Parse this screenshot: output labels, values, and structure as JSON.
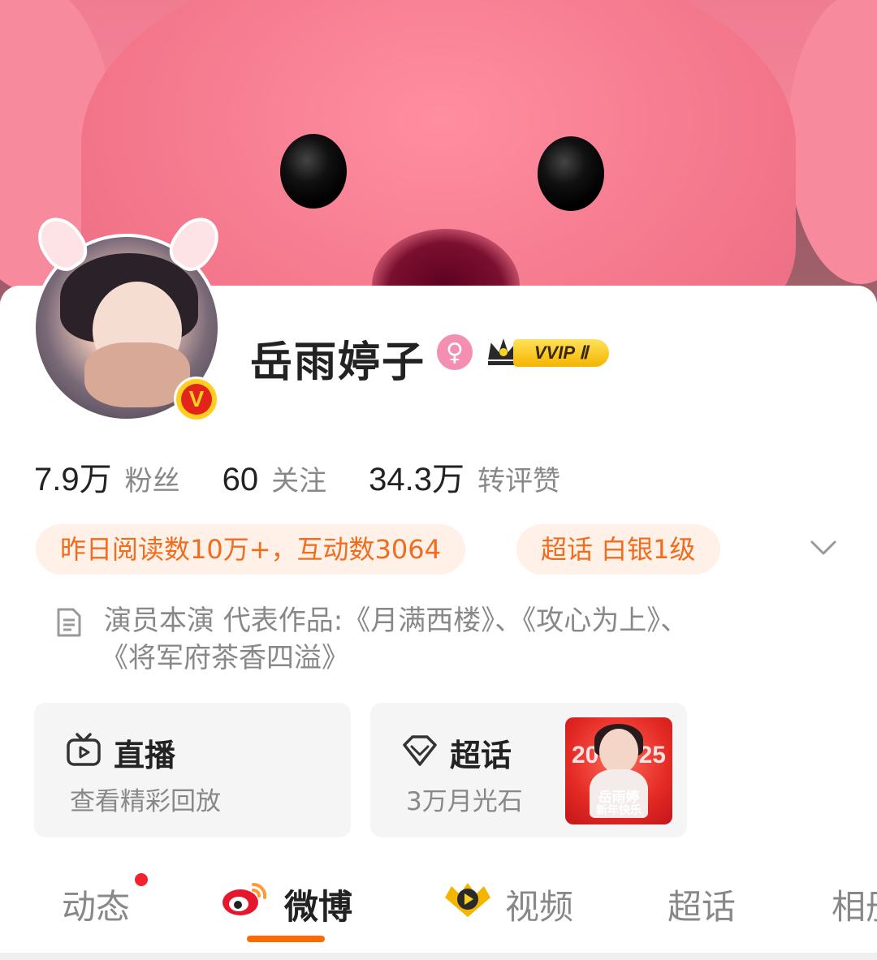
{
  "profile": {
    "name": "岳雨婷子",
    "gender_icon": "female-icon",
    "vip_label": "VVIP Ⅱ",
    "verified_badge": "V"
  },
  "stats": [
    {
      "value": "7.9万",
      "label": "粉丝"
    },
    {
      "value": "60",
      "label": "关注"
    },
    {
      "value": "34.3万",
      "label": "转评赞"
    }
  ],
  "chips": {
    "reading": "昨日阅读数10万+，互动数3064",
    "supertopic_level": "超话 白银1级"
  },
  "intro": {
    "line1": "演员本演  代表作品:《月满西楼》、《攻心为上》、",
    "line2": "《将军府茶香四溢》"
  },
  "tiles": {
    "live": {
      "title": "直播",
      "subtitle": "查看精彩回放"
    },
    "supertopic": {
      "title": "超话",
      "subtitle": "3万月光石",
      "poster_line1": "岳雨婷",
      "poster_line2": "新年快乐",
      "poster_num_left": "20",
      "poster_num_right": "25"
    }
  },
  "tabs": [
    {
      "label": "动态"
    },
    {
      "label": "微博"
    },
    {
      "label": "视频"
    },
    {
      "label": "超话"
    },
    {
      "label": "相册"
    }
  ],
  "colors": {
    "accent": "#ff6a00",
    "chip_text": "#f36b1c",
    "chip_bg": "#fff1e8",
    "notification_dot": "#f5222d"
  }
}
